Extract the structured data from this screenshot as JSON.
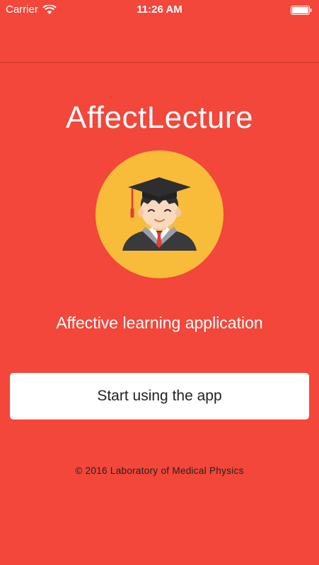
{
  "status_bar": {
    "carrier": "Carrier",
    "time": "11:26 AM",
    "wifi_icon": "wifi-icon",
    "battery_icon": "battery-icon"
  },
  "main": {
    "title": "AffectLecture",
    "avatar_icon": "graduate-avatar-icon",
    "subtitle": "Affective learning application",
    "start_button_label": "Start using the app",
    "footer": "© 2016 Laboratory of Medical Physics"
  },
  "colors": {
    "background": "#f2473a",
    "avatar_circle": "#f9bc3a",
    "button_background": "#ffffff",
    "text_light": "#ffffff",
    "text_dark": "#222222"
  }
}
